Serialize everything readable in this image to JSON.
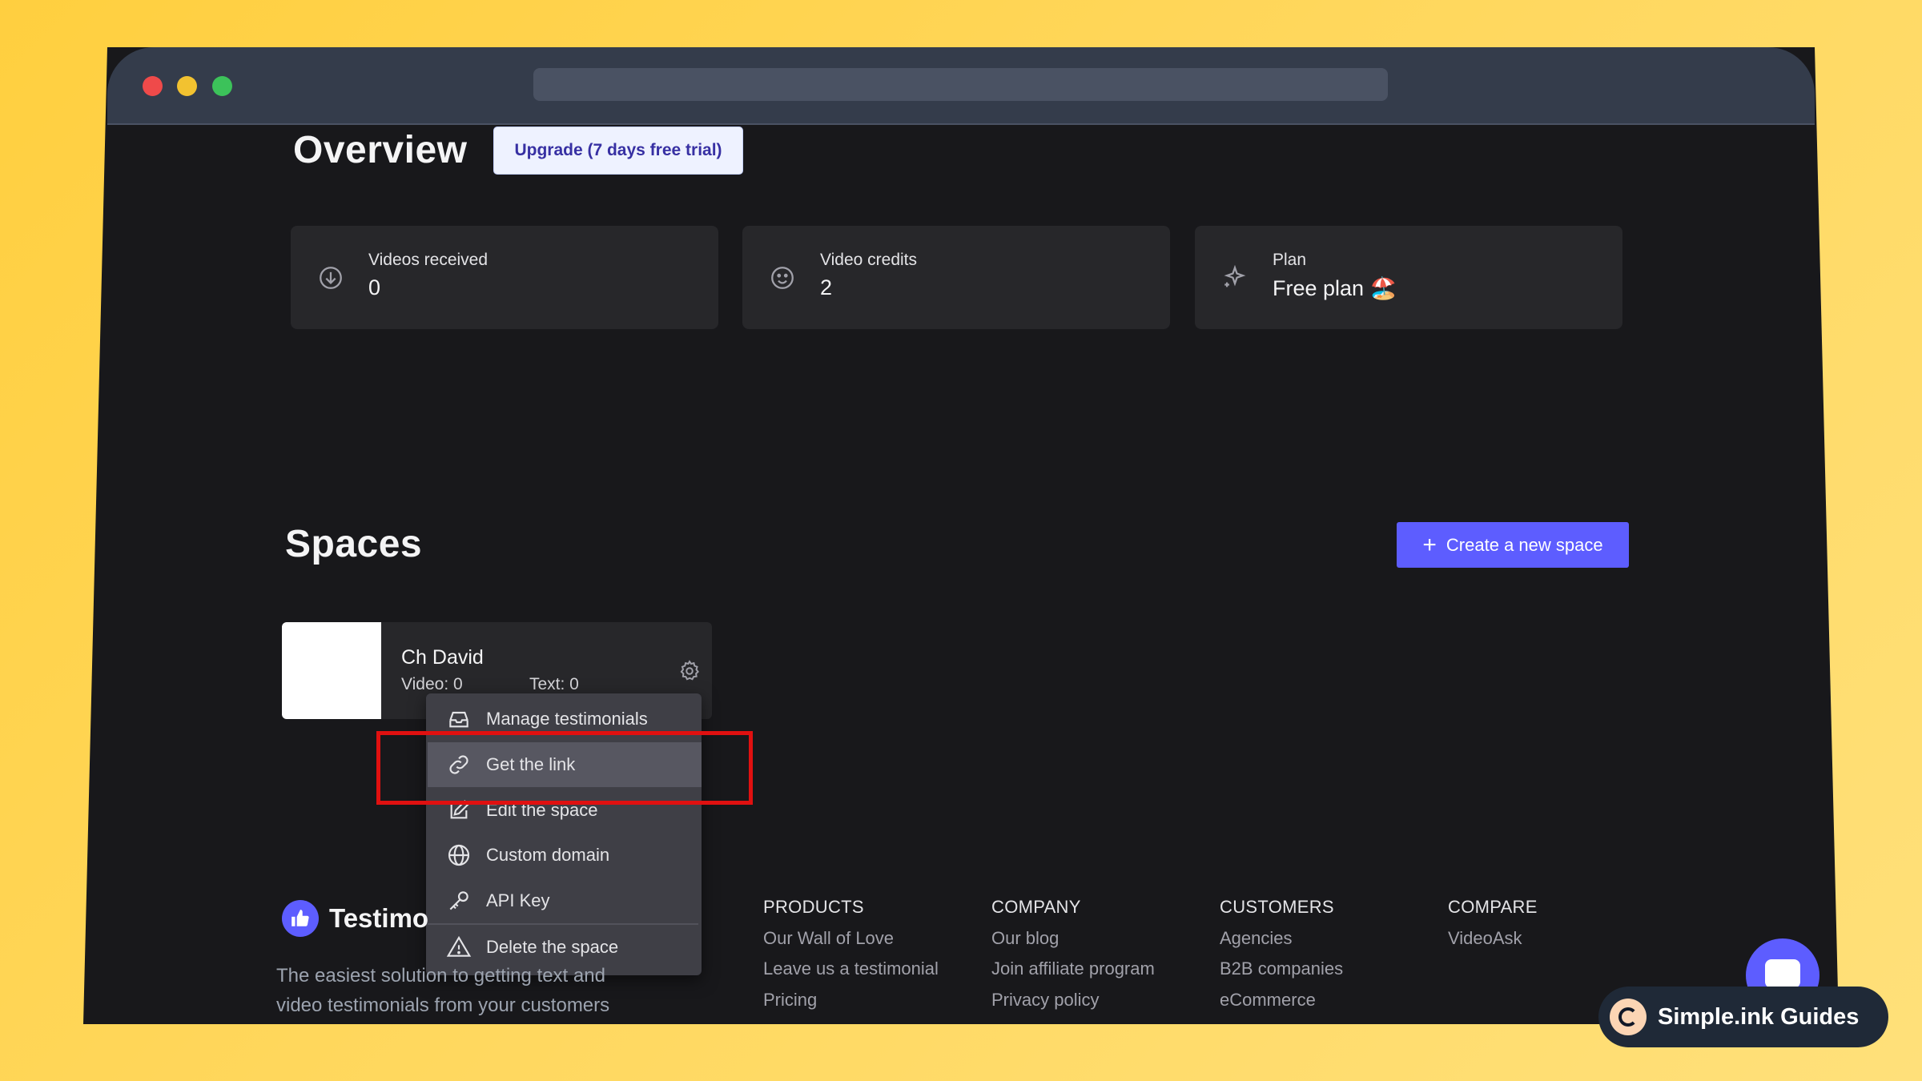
{
  "header": {
    "title": "Overview",
    "upgrade_label": "Upgrade (7 days free trial)"
  },
  "stats": [
    {
      "label": "Videos received",
      "value": "0",
      "icon": "download-circle-icon"
    },
    {
      "label": "Video credits",
      "value": "2",
      "icon": "smile-icon"
    },
    {
      "label": "Plan",
      "value": "Free plan 🏖️",
      "icon": "sparkles-icon"
    }
  ],
  "spaces": {
    "title": "Spaces",
    "create_label": "Create a new space",
    "space": {
      "name": "Ch David",
      "video": "Video: 0",
      "text": "Text: 0"
    }
  },
  "menu": {
    "items": [
      {
        "label": "Manage testimonials",
        "icon": "inbox-icon"
      },
      {
        "label": "Get the link",
        "icon": "link-icon"
      },
      {
        "label": "Edit the space",
        "icon": "edit-icon"
      },
      {
        "label": "Custom domain",
        "icon": "globe-icon"
      },
      {
        "label": "API Key",
        "icon": "key-icon"
      },
      {
        "label": "Delete the space",
        "icon": "warning-icon"
      }
    ]
  },
  "footer": {
    "brand": "Testimo",
    "tagline_1": "The easiest solution to getting text and",
    "tagline_2": "video testimonials from your customers",
    "columns": [
      {
        "heading": "PRODUCTS",
        "links": [
          "Our Wall of Love",
          "Leave us a testimonial",
          "Pricing"
        ]
      },
      {
        "heading": "COMPANY",
        "links": [
          "Our blog",
          "Join affiliate program",
          "Privacy policy"
        ]
      },
      {
        "heading": "CUSTOMERS",
        "links": [
          "Agencies",
          "B2B companies",
          "eCommerce"
        ]
      },
      {
        "heading": "COMPARE",
        "links": [
          "VideoAsk"
        ]
      }
    ]
  },
  "badge": {
    "label": "Simple.ink Guides"
  },
  "colors": {
    "accent": "#5d5dff",
    "highlight": "#e01010",
    "window_bg": "#18181b",
    "card_bg": "#27272a"
  }
}
